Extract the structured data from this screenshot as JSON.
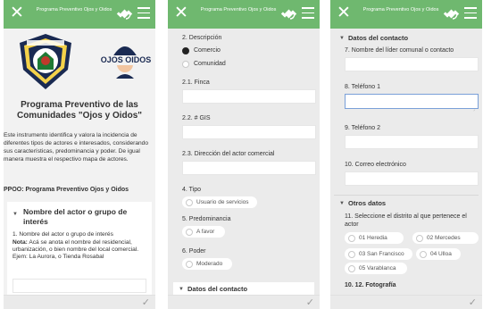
{
  "app": {
    "title": "Programa Preventivo Ojos y Oidos",
    "close_icon": "close-icon",
    "sync_icon": "satellite-icon",
    "menu_icon": "hamburger-menu-icon",
    "submit_icon": "checkmark-icon",
    "header_color": "#6fb86f"
  },
  "screen1": {
    "logo_text": "OJOS OIDOS",
    "heading": "Programa Preventivo de las Comunidades \"Ojos y Oidos\"",
    "description": "Este instrumento identifica y valora la incidencia de diferentes tipos de actores e interesados, considerando sus características, predominancia y poder. De igual manera muestra el respectivo mapa de actores.",
    "ppoo": "PPOO: Programa Preventivo Ojos y Oidos",
    "section_title": "Nombre del actor o grupo de interés",
    "q1_label": "1. Nombre del actor o grupo de interés",
    "q1_note_bold": "Nota:",
    "q1_note": " Acá se anota el nombre del residencial, urbanización, o bien nombre del local comercial. Ejem: La Aurora, o Tienda Rosabal"
  },
  "screen2": {
    "q2_label": "2. Descripción",
    "q2_options": [
      {
        "label": "Comercio",
        "selected": true
      },
      {
        "label": "Comunidad",
        "selected": false
      }
    ],
    "q21_label": "2.1. Finca",
    "q22_label": "2.2. # GIS",
    "q23_label": "2.3. Dirección del actor comercial",
    "q4_label": "4. Tipo",
    "q4_value": "Usuario de servicios",
    "q5_label": "5. Predominancia",
    "q5_value": "A favor",
    "q6_label": "6. Poder",
    "q6_value": "Moderado",
    "next_section": "Datos del contacto"
  },
  "screen3": {
    "section1_title": "Datos del contacto",
    "q7_label": "7. Nombre del líder comunal o contacto",
    "q8_label": "8. Teléfono 1",
    "q9_label": "9. Teléfono 2",
    "q10_label": "10. Correo electrónico",
    "section2_title": "Otros datos",
    "q11_label": "11. Seleccione el distrito al que pertenece el actor",
    "districts": [
      "01 Heredia",
      "02 Mercedes",
      "03 San Francisco",
      "04 Ulloa",
      "05 Varablanca"
    ],
    "q1012_label": "10. 12. Fotografía"
  }
}
